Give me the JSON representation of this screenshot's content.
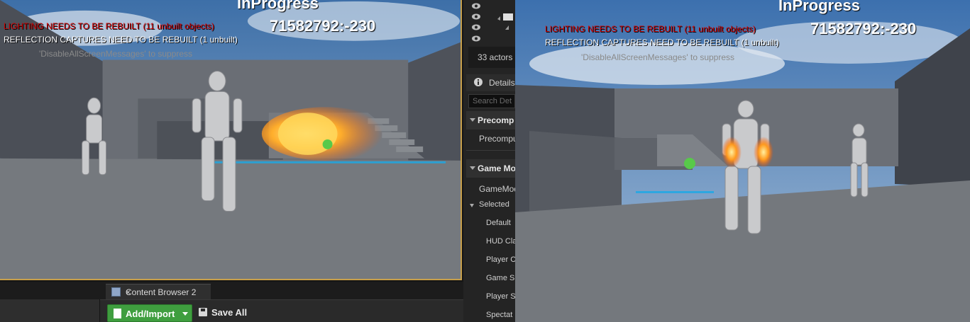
{
  "viewport_left": {
    "messages": {
      "lighting": "LIGHTING NEEDS TO BE REBUILT (11 unbuilt objects)",
      "reflection": "REFLECTION CAPTURES NEED TO BE REBUILT (1 unbuilt)",
      "suppress": "'DisableAllScreenMessages' to suppress"
    },
    "status": "InProgress",
    "id_text": "71582792:-230"
  },
  "viewport_right": {
    "messages": {
      "lighting": "LIGHTING NEEDS TO BE REBUILT (11 unbuilt objects)",
      "reflection": "REFLECTION CAPTURES NEED TO BE REBUILT (1 unbuilt)",
      "suppress": "'DisableAllScreenMessages' to suppress"
    },
    "status": "InProgress",
    "id_text": "71582792:-230"
  },
  "outliner": {
    "actor_count": "33 actors"
  },
  "details": {
    "tab_label": "Details",
    "search_placeholder": "Search Det",
    "sections": [
      {
        "title": "Precomp",
        "items": [
          "Precompu"
        ]
      },
      {
        "title": "Game Mo",
        "items": [
          "GameMod"
        ]
      }
    ],
    "selected_label": "Selected",
    "properties": [
      "Default",
      "HUD Cla",
      "Player C",
      "Game S",
      "Player S",
      "Spectat"
    ]
  },
  "content_browser": {
    "tab_label": "Content Browser 2",
    "close_glyph": "×",
    "add_import_label": "Add/Import",
    "save_all_label": "Save All"
  },
  "colors": {
    "accent_border": "#c8a04a",
    "add_button": "#3f9e3f",
    "warning_red": "#d40000"
  }
}
